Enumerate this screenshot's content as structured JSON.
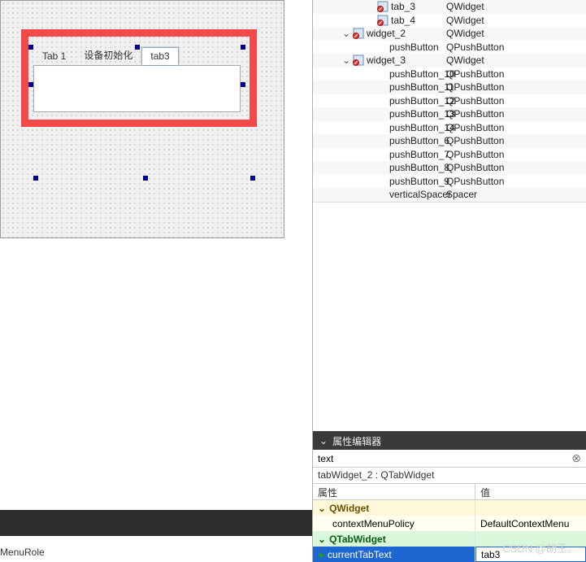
{
  "designer": {
    "tabs": [
      {
        "label": "Tab 1",
        "active": false
      },
      {
        "label": "设备初始化",
        "active": false
      },
      {
        "label": "tab3",
        "active": true
      }
    ]
  },
  "object_tree": {
    "rows": [
      {
        "indent": 60,
        "expander": "",
        "icon": "nolayout",
        "name": "tab_3",
        "class": "QWidget"
      },
      {
        "indent": 60,
        "expander": "",
        "icon": "nolayout",
        "name": "tab_4",
        "class": "QWidget"
      },
      {
        "indent": 30,
        "expander": "v",
        "icon": "nolayout",
        "name": "widget_2",
        "class": "QWidget"
      },
      {
        "indent": 76,
        "expander": "",
        "icon": "",
        "name": "pushButton",
        "class": "QPushButton"
      },
      {
        "indent": 30,
        "expander": "v",
        "icon": "nolayout",
        "name": "widget_3",
        "class": "QWidget"
      },
      {
        "indent": 76,
        "expander": "",
        "icon": "",
        "name": "pushButton_10",
        "class": "QPushButton"
      },
      {
        "indent": 76,
        "expander": "",
        "icon": "",
        "name": "pushButton_11",
        "class": "QPushButton"
      },
      {
        "indent": 76,
        "expander": "",
        "icon": "",
        "name": "pushButton_12",
        "class": "QPushButton"
      },
      {
        "indent": 76,
        "expander": "",
        "icon": "",
        "name": "pushButton_13",
        "class": "QPushButton"
      },
      {
        "indent": 76,
        "expander": "",
        "icon": "",
        "name": "pushButton_14",
        "class": "QPushButton"
      },
      {
        "indent": 76,
        "expander": "",
        "icon": "",
        "name": "pushButton_6",
        "class": "QPushButton"
      },
      {
        "indent": 76,
        "expander": "",
        "icon": "",
        "name": "pushButton_7",
        "class": "QPushButton"
      },
      {
        "indent": 76,
        "expander": "",
        "icon": "",
        "name": "pushButton_8",
        "class": "QPushButton"
      },
      {
        "indent": 76,
        "expander": "",
        "icon": "",
        "name": "pushButton_9",
        "class": "QPushButton"
      },
      {
        "indent": 76,
        "expander": "",
        "icon": "",
        "name": "verticalSpacer",
        "class": "Spacer"
      }
    ]
  },
  "property_editor": {
    "title": "属性编辑器",
    "filter_label": "text",
    "context": "tabWidget_2 : QTabWidget",
    "col_key": "属性",
    "col_val": "值",
    "group_qwidget": "QWidget",
    "contextMenuPolicy_key": "contextMenuPolicy",
    "contextMenuPolicy_val": "DefaultContextMenu",
    "group_qtabwidget": "QTabWidget",
    "currentTabText_key": "currentTabText",
    "currentTabText_val": "tab3"
  },
  "bottom": {
    "menurole": "MenuRole"
  },
  "watermark": "CSDN @胡玉。"
}
